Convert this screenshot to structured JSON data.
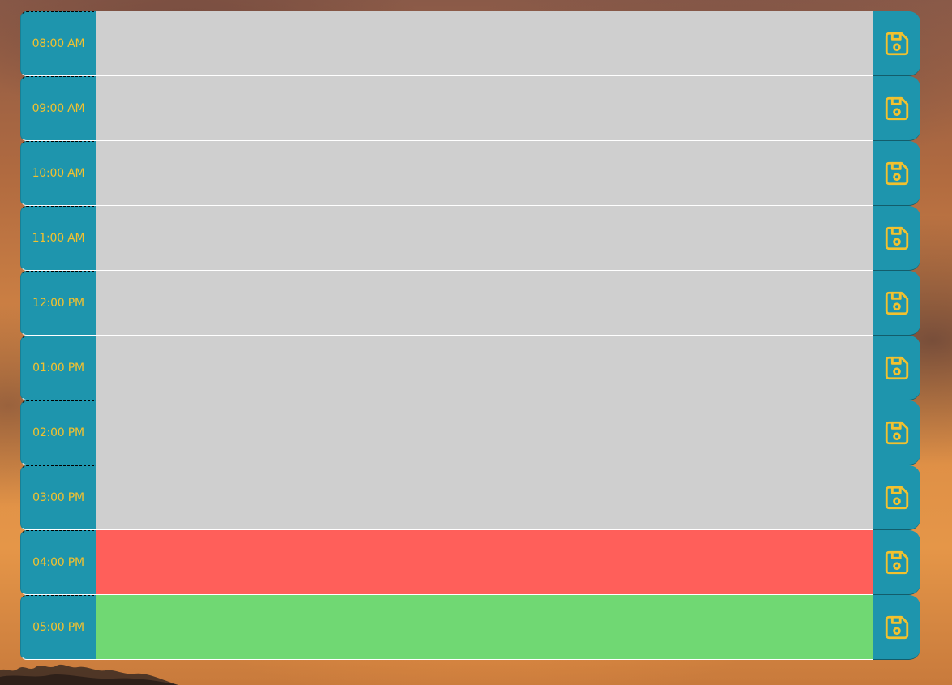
{
  "colors": {
    "hour_bg": "#1e95ad",
    "hour_text": "#f2c12e",
    "past": "#cfcfcf",
    "present": "#ff5f5a",
    "future": "#70d873",
    "save_icon": "#f2c12e"
  },
  "save_icon": "floppy-disk-icon",
  "time_blocks": [
    {
      "hour": "08:00 AM",
      "state": "past",
      "text": ""
    },
    {
      "hour": "09:00 AM",
      "state": "past",
      "text": ""
    },
    {
      "hour": "10:00 AM",
      "state": "past",
      "text": ""
    },
    {
      "hour": "11:00 AM",
      "state": "past",
      "text": ""
    },
    {
      "hour": "12:00 PM",
      "state": "past",
      "text": ""
    },
    {
      "hour": "01:00 PM",
      "state": "past",
      "text": ""
    },
    {
      "hour": "02:00 PM",
      "state": "past",
      "text": ""
    },
    {
      "hour": "03:00 PM",
      "state": "past",
      "text": ""
    },
    {
      "hour": "04:00 PM",
      "state": "present",
      "text": ""
    },
    {
      "hour": "05:00 PM",
      "state": "future",
      "text": ""
    }
  ]
}
